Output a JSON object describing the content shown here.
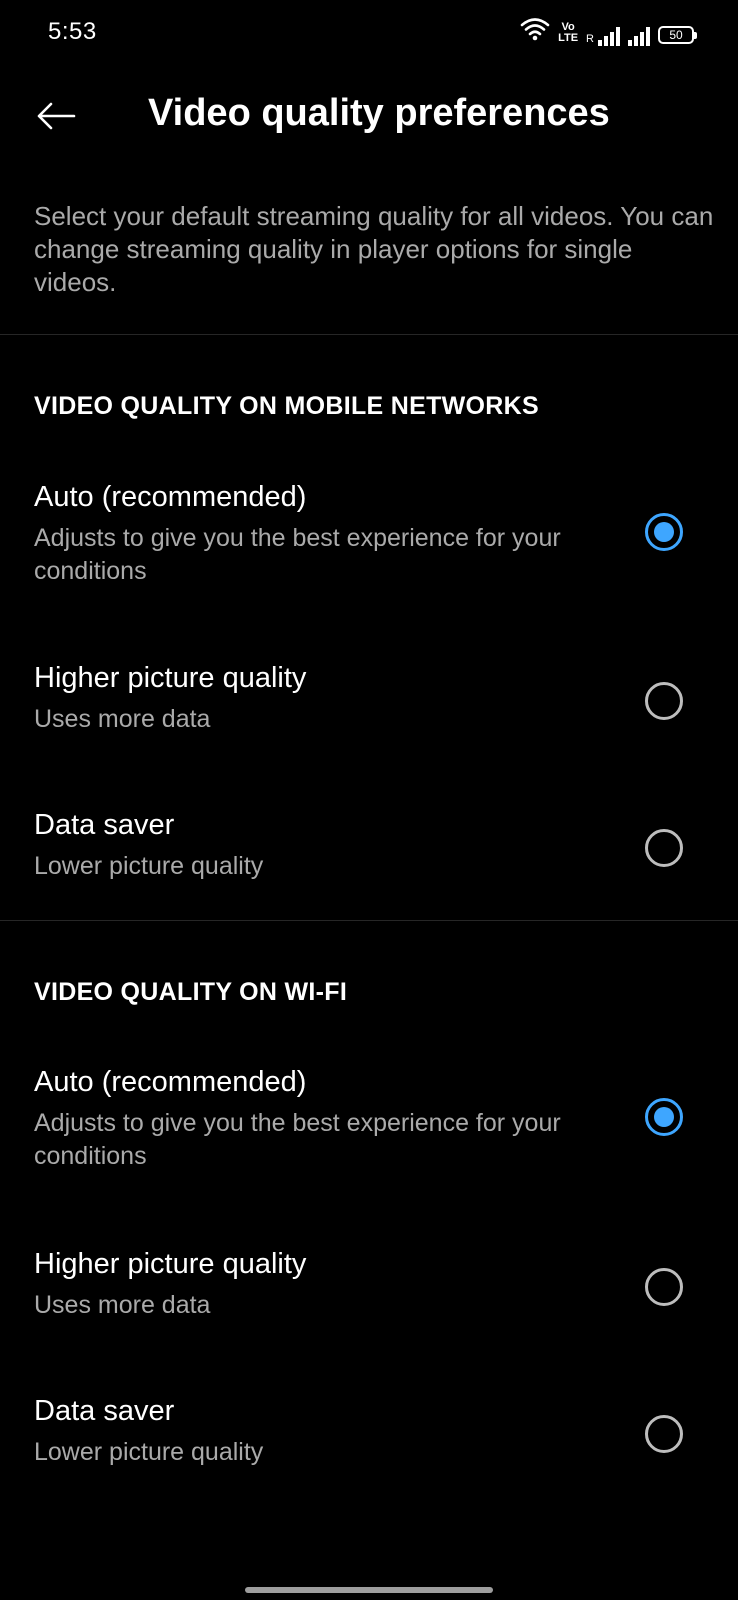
{
  "status_bar": {
    "time": "5:53",
    "volte_top": "Vo",
    "volte_bottom": "LTE",
    "roaming": "R",
    "battery": "50"
  },
  "header": {
    "title": "Video quality preferences",
    "back_icon": "arrow-left-icon"
  },
  "description": "Select your default streaming quality for all videos. You can change streaming quality in player options for single videos.",
  "sections": [
    {
      "header": "VIDEO QUALITY ON MOBILE NETWORKS",
      "options": [
        {
          "title": "Auto (recommended)",
          "subtitle": "Adjusts to give you the best experience for your conditions",
          "selected": true
        },
        {
          "title": "Higher picture quality",
          "subtitle": "Uses more data",
          "selected": false
        },
        {
          "title": "Data saver",
          "subtitle": "Lower picture quality",
          "selected": false
        }
      ]
    },
    {
      "header": "VIDEO QUALITY ON WI-FI",
      "options": [
        {
          "title": "Auto (recommended)",
          "subtitle": "Adjusts to give you the best experience for your conditions",
          "selected": true
        },
        {
          "title": "Higher picture quality",
          "subtitle": "Uses more data",
          "selected": false
        },
        {
          "title": "Data saver",
          "subtitle": "Lower picture quality",
          "selected": false
        }
      ]
    }
  ],
  "colors": {
    "background": "#000000",
    "accent": "#3ea6ff",
    "secondary_text": "#aaaaaa"
  }
}
